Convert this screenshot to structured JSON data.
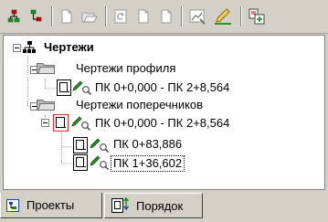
{
  "toolbar": {
    "icons": [
      "tree-expand-icon",
      "tree-collapse-icon",
      "new-document-icon",
      "open-folder-icon",
      "refresh-icon",
      "page-icon",
      "page-icon",
      "chart-settings-icon",
      "edit-pencil-icon",
      "export-icon"
    ]
  },
  "tree": {
    "root": "Чертежи",
    "profiles": "Чертежи профиля",
    "profile_item": "ПК 0+0,000 - ПК 2+8,564",
    "cross": "Чертежи поперечников",
    "cross_item": "ПК 0+0,000 - ПК 2+8,564",
    "cross_sub1": "ПК 0+83,886",
    "cross_sub2": "ПК 1+36,602"
  },
  "tabs": {
    "projects": "Проекты",
    "order": "Порядок"
  },
  "colors": {
    "selected_border": "#e03030",
    "accent_green": "#2a8a2a"
  }
}
